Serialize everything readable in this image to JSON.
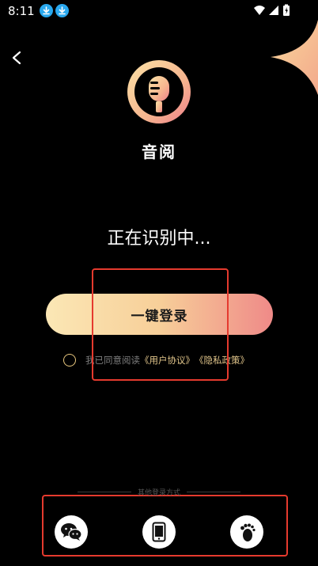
{
  "status_bar": {
    "time": "8:11",
    "left_icons": [
      "download-icon",
      "download-icon"
    ],
    "right_icons": [
      "wifi-icon",
      "signal-icon",
      "battery-icon"
    ]
  },
  "header": {
    "back_icon": "chevron-left-icon"
  },
  "app": {
    "name": "音阅",
    "logo_icon": "microphone-icon"
  },
  "main": {
    "status_text": "正在识别中...",
    "login_button": "一键登录",
    "agreement": {
      "prefix": "我已同意阅读",
      "user_agreement": "《用户协议》",
      "privacy_policy": "《隐私政策》"
    }
  },
  "other_login": {
    "title": "其他登录方式",
    "methods": [
      {
        "icon": "wechat-icon"
      },
      {
        "icon": "phone-icon"
      },
      {
        "icon": "footprint-icon"
      }
    ]
  },
  "colors": {
    "accent_red": "#e53a2e",
    "link_gold": "#e2c68b",
    "button_gradient": [
      "#fbe7b5",
      "#f7cf99",
      "#ef8a88"
    ]
  }
}
